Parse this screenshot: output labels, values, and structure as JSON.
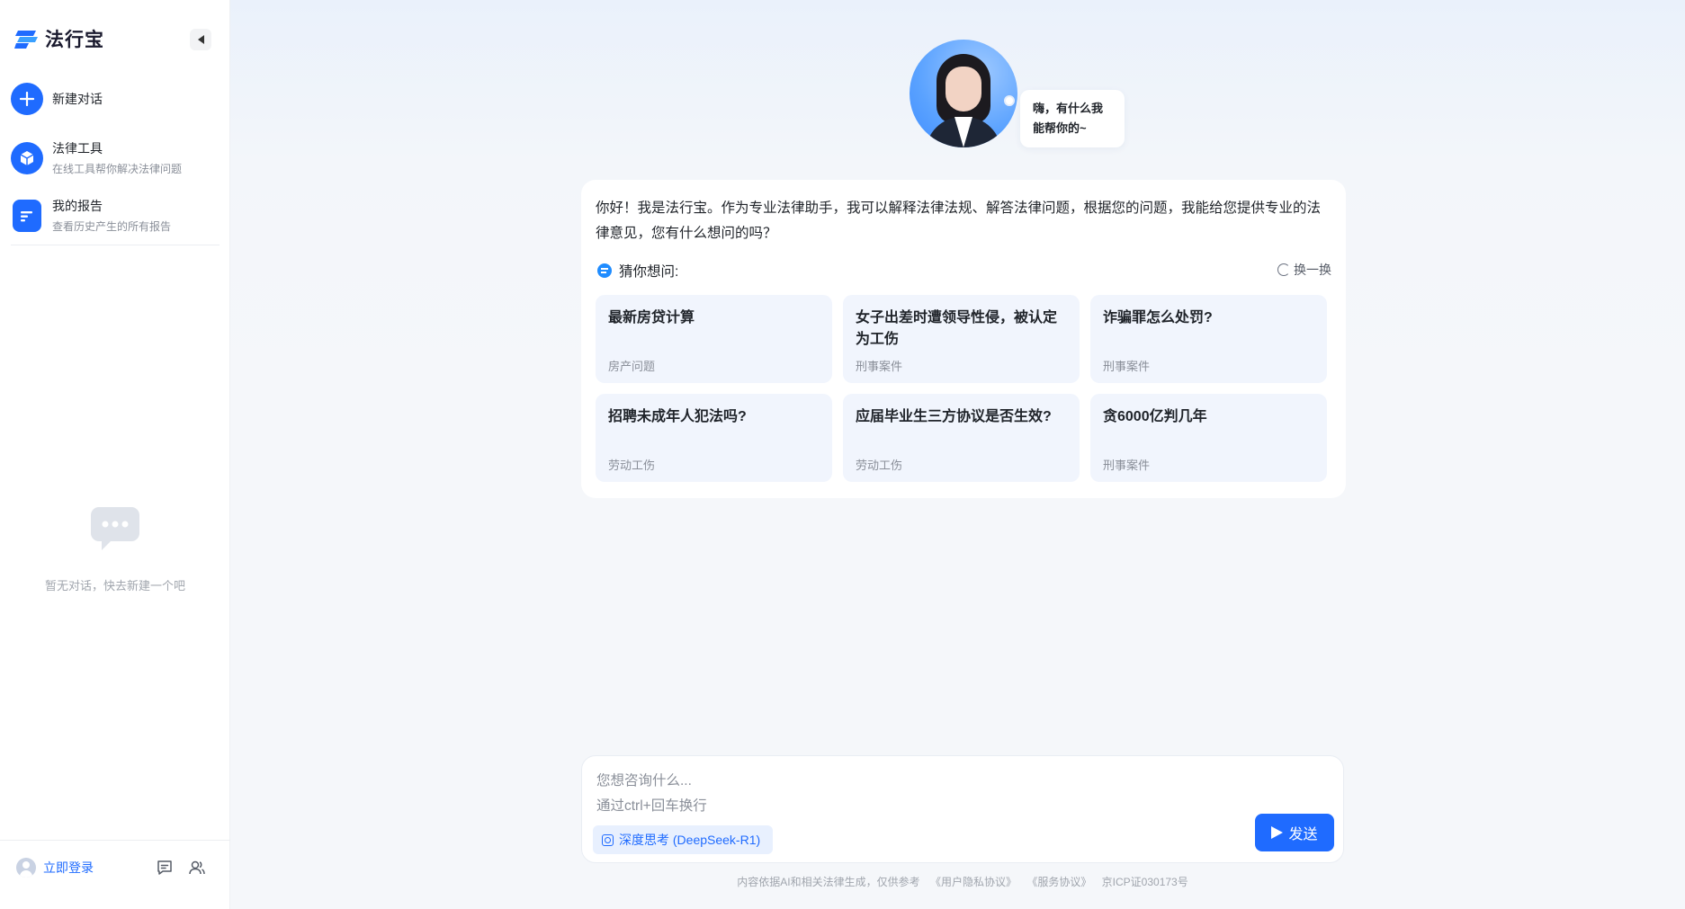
{
  "app": {
    "name": "法行宝"
  },
  "sidebar": {
    "new_chat": {
      "label": "新建对话"
    },
    "items": [
      {
        "title": "法律工具",
        "subtitle": "在线工具帮你解决法律问题",
        "icon": "cube-icon"
      },
      {
        "title": "我的报告",
        "subtitle": "查看历史产生的所有报告",
        "icon": "report-icon"
      }
    ],
    "empty_text": "暂无对话，快去新建一个吧",
    "login_label": "立即登录"
  },
  "assistant": {
    "greeting": "嗨，有什么我能帮你的~"
  },
  "intro": "你好！我是法行宝。作为专业法律助手，我可以解释法律法规、解答法律问题，根据您的问题，我能给您提供专业的法律意见，您有什么想问的吗？",
  "suggestions": {
    "title": "猜你想问:",
    "refresh_label": "换一换",
    "questions": [
      {
        "title": "最新房贷计算",
        "tag": "房产问题"
      },
      {
        "title": "女子出差时遭领导性侵，被认定为工伤",
        "tag": "刑事案件"
      },
      {
        "title": "诈骗罪怎么处罚?",
        "tag": "刑事案件"
      },
      {
        "title": "招聘未成年人犯法吗?",
        "tag": "劳动工伤"
      },
      {
        "title": "应届毕业生三方协议是否生效?",
        "tag": "劳动工伤"
      },
      {
        "title": "贪6000亿判几年",
        "tag": "刑事案件"
      }
    ]
  },
  "input": {
    "placeholder": "您想咨询什么...\n通过ctrl+回车换行",
    "mode_label": "深度思考 (DeepSeek-R1)",
    "send_label": "发送"
  },
  "footer": {
    "disclaimer": "内容依据AI和相关法律生成，仅供参考",
    "privacy": "《用户隐私协议》",
    "service": "《服务协议》",
    "icp": "京ICP证030173号"
  },
  "colors": {
    "accent": "#1f6bff",
    "card_bg": "#f1f5fd"
  }
}
